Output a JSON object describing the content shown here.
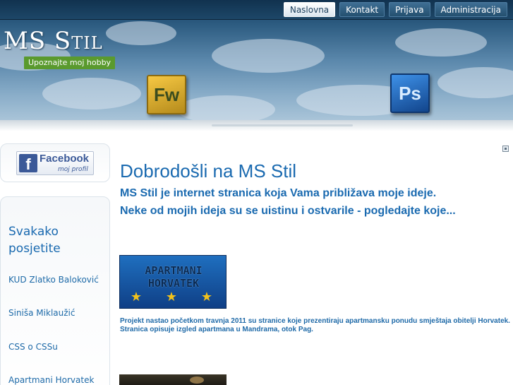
{
  "nav": {
    "items": [
      {
        "label": "Naslovna",
        "active": true
      },
      {
        "label": "Kontakt",
        "active": false
      },
      {
        "label": "Prijava",
        "active": false
      },
      {
        "label": "Administracija",
        "active": false
      }
    ]
  },
  "header": {
    "logo": "MS Stil",
    "tagline": "Upoznajte moj hobby",
    "icons": [
      {
        "name": "fireworks-icon",
        "label": "Fw"
      },
      {
        "name": "photoshop-icon",
        "label": "Ps"
      }
    ]
  },
  "sidebar": {
    "facebook": {
      "title": "Facebook",
      "subtitle": "moj profil",
      "icon": "f"
    },
    "heading": "Svakako posjetite",
    "links": [
      "KUD Zlatko Baloković",
      "Siniša Miklaužić",
      "CSS o CSSu",
      "Apartmani Horvatek"
    ]
  },
  "main": {
    "title": "Dobrodošli na MS Stil",
    "intro": [
      "MS Stil je internet stranica koja Vama približava moje ideje.",
      "Neke od mojih ideja su se uistinu i ostvarile - pogledajte koje..."
    ],
    "banner": {
      "line1": "APARTMANI",
      "line2": "HORVATEK",
      "stars": 3
    },
    "description": [
      " Projekt nastao početkom travnja 2011 su stranice koje prezentiraju apartmansku ponudu smještaja obitelji Horvatek.",
      "Stranica opisuje izgled apartmana u Mandrama, otok Pag."
    ]
  },
  "colors": {
    "accent": "#1a6ab0",
    "badge": "#5a9a2e",
    "facebook": "#3b5998",
    "header_dark": "#173d5e"
  }
}
